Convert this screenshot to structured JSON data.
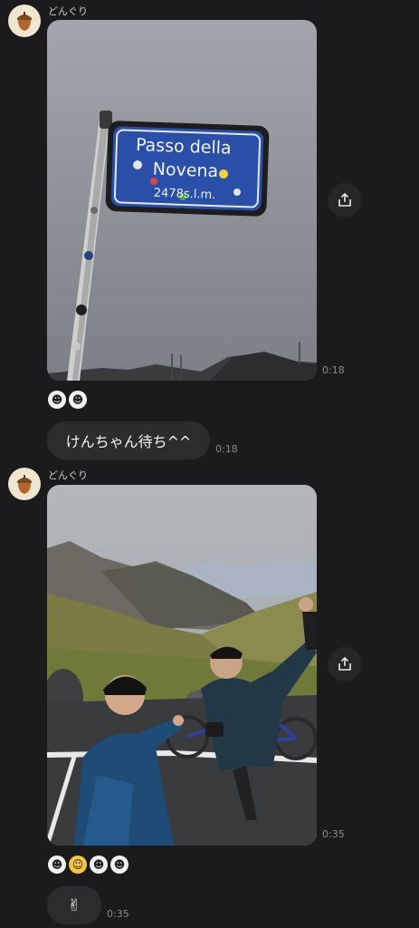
{
  "messages": [
    {
      "sender": "どんぐり",
      "photo_sign_line1": "Passo della",
      "photo_sign_line2": "Novena",
      "photo_sign_line3": "2478s.l.m.",
      "photo_time": "0:18",
      "reactions": [
        "sticker-face",
        "sticker-face"
      ],
      "text": "けんちゃん待ち^^",
      "text_time": "0:18"
    },
    {
      "sender": "どんぐり",
      "photo_time": "0:35",
      "reactions": [
        "sticker-face",
        "sticker-cat",
        "sticker-face",
        "sticker-face"
      ],
      "text": "✌",
      "text_time": "0:35"
    }
  ],
  "colors": {
    "background": "#1b1b1d",
    "bubble": "#2c2c2e",
    "sign_blue": "#2a4fa8"
  }
}
